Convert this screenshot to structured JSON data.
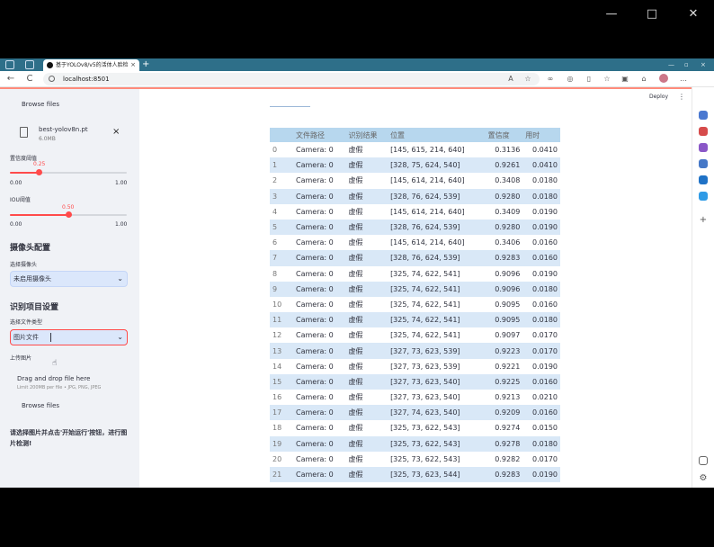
{
  "window": {
    "minimize": "—",
    "maximize": "□",
    "close": "✕"
  },
  "browser": {
    "tab_title": "基于YOLOv8/v5的活体人脸检测系统",
    "tab_close": "×",
    "new_tab": "+",
    "url": "localhost:8501",
    "back": "←",
    "reload": "C"
  },
  "sidebar": {
    "browse_top": "Browse files",
    "uploaded_file": {
      "name": "best-yolov8n.pt",
      "size": "6.0MB",
      "remove": "×"
    },
    "confidence": {
      "label": "置信度阈值",
      "value": "0.25",
      "value_fraction": 0.25,
      "min": "0.00",
      "max": "1.00"
    },
    "iou": {
      "label": "IOU阈值",
      "value": "0.50",
      "value_fraction": 0.5,
      "min": "0.00",
      "max": "1.00"
    },
    "camera_section": {
      "title": "摄像头配置",
      "select_label": "选择摄像头",
      "select_value": "未启用摄像头"
    },
    "project_section": {
      "title": "识别项目设置",
      "file_type_label": "选择文件类型",
      "file_type_value": "图片文件"
    },
    "upload": {
      "label": "上传图片",
      "drag_text": "Drag and drop file here",
      "limit_text": "Limit 200MB per file • JPG, PNG, JPEG",
      "browse": "Browse files"
    },
    "instruction": "请选择图片并点击'开始运行'按钮，进行图片检测!"
  },
  "main": {
    "deploy": "Deploy",
    "menu": "⋮",
    "table": {
      "headers": [
        "",
        "文件路径",
        "识别结果",
        "位置",
        "置信度",
        "用时"
      ],
      "rows": [
        [
          "0",
          "Camera: 0",
          "虚假",
          "[145, 615, 214, 640]",
          "0.3136",
          "0.0410"
        ],
        [
          "1",
          "Camera: 0",
          "虚假",
          "[328, 75, 624, 540]",
          "0.9261",
          "0.0410"
        ],
        [
          "2",
          "Camera: 0",
          "虚假",
          "[145, 614, 214, 640]",
          "0.3408",
          "0.0180"
        ],
        [
          "3",
          "Camera: 0",
          "虚假",
          "[328, 76, 624, 539]",
          "0.9280",
          "0.0180"
        ],
        [
          "4",
          "Camera: 0",
          "虚假",
          "[145, 614, 214, 640]",
          "0.3409",
          "0.0190"
        ],
        [
          "5",
          "Camera: 0",
          "虚假",
          "[328, 76, 624, 539]",
          "0.9280",
          "0.0190"
        ],
        [
          "6",
          "Camera: 0",
          "虚假",
          "[145, 614, 214, 640]",
          "0.3406",
          "0.0160"
        ],
        [
          "7",
          "Camera: 0",
          "虚假",
          "[328, 76, 624, 539]",
          "0.9283",
          "0.0160"
        ],
        [
          "8",
          "Camera: 0",
          "虚假",
          "[325, 74, 622, 541]",
          "0.9096",
          "0.0190"
        ],
        [
          "9",
          "Camera: 0",
          "虚假",
          "[325, 74, 622, 541]",
          "0.9096",
          "0.0180"
        ],
        [
          "10",
          "Camera: 0",
          "虚假",
          "[325, 74, 622, 541]",
          "0.9095",
          "0.0160"
        ],
        [
          "11",
          "Camera: 0",
          "虚假",
          "[325, 74, 622, 541]",
          "0.9095",
          "0.0180"
        ],
        [
          "12",
          "Camera: 0",
          "虚假",
          "[325, 74, 622, 541]",
          "0.9097",
          "0.0170"
        ],
        [
          "13",
          "Camera: 0",
          "虚假",
          "[327, 73, 623, 539]",
          "0.9223",
          "0.0170"
        ],
        [
          "14",
          "Camera: 0",
          "虚假",
          "[327, 73, 623, 539]",
          "0.9221",
          "0.0190"
        ],
        [
          "15",
          "Camera: 0",
          "虚假",
          "[327, 73, 623, 540]",
          "0.9225",
          "0.0160"
        ],
        [
          "16",
          "Camera: 0",
          "虚假",
          "[327, 73, 623, 540]",
          "0.9213",
          "0.0210"
        ],
        [
          "17",
          "Camera: 0",
          "虚假",
          "[327, 74, 623, 540]",
          "0.9209",
          "0.0160"
        ],
        [
          "18",
          "Camera: 0",
          "虚假",
          "[325, 73, 622, 543]",
          "0.9274",
          "0.0150"
        ],
        [
          "19",
          "Camera: 0",
          "虚假",
          "[325, 73, 622, 543]",
          "0.9278",
          "0.0180"
        ],
        [
          "20",
          "Camera: 0",
          "虚假",
          "[325, 73, 622, 543]",
          "0.9282",
          "0.0170"
        ],
        [
          "21",
          "Camera: 0",
          "虚假",
          "[325, 73, 623, 544]",
          "0.9283",
          "0.0190"
        ]
      ]
    }
  },
  "colors": {
    "sidebar_bg": "#f0f2f6",
    "accent_red": "#ff4b4b",
    "table_header": "#b7d7ee",
    "table_stripe": "#d9e8f7",
    "browser_tab_bar": "#2e6f89"
  }
}
